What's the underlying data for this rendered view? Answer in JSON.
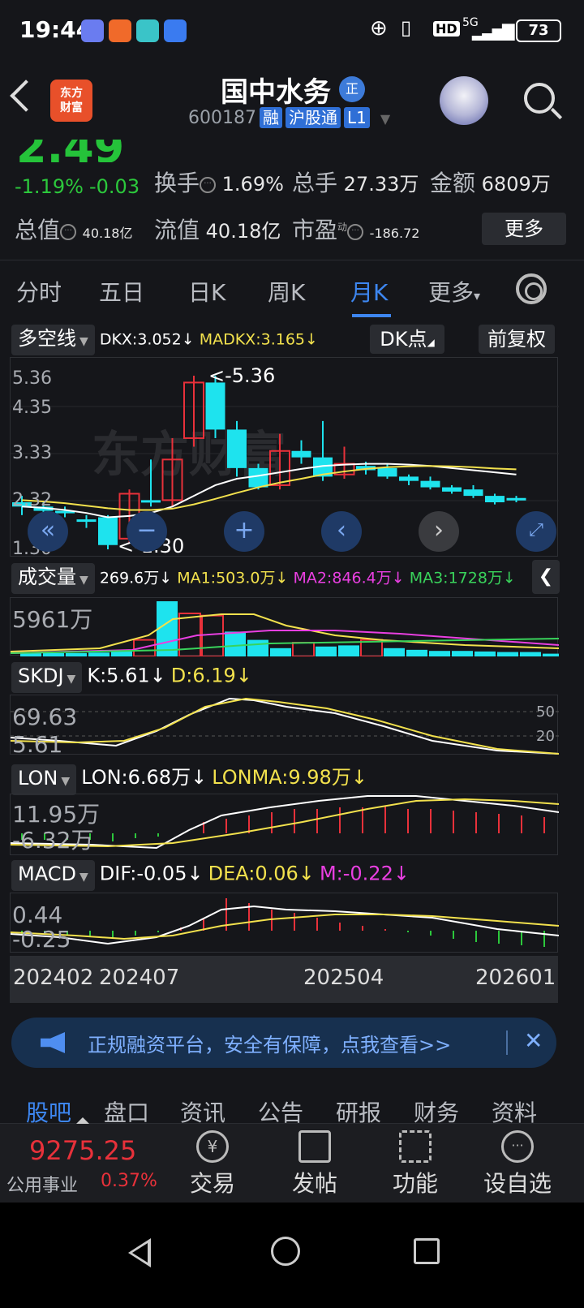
{
  "status_bar": {
    "time": "19:44",
    "network": "5G",
    "hd": "HD",
    "battery": "73"
  },
  "header": {
    "logo_line1": "东方",
    "logo_line2": "财富",
    "stock_name": "国中水务",
    "badge": "正",
    "code": "600187",
    "tags": [
      "融",
      "沪股通",
      "L1"
    ]
  },
  "quote": {
    "price": "2.49",
    "change_pct": "-1.19%",
    "change_amt": "-0.03",
    "turnover_label": "换手",
    "turnover_value": "1.69%",
    "volume_label": "总手",
    "volume_value": "27.33万",
    "amount_label": "金额",
    "amount_value": "6809万",
    "mktcap_label": "总值",
    "mktcap_value": "40.18亿",
    "float_label": "流值",
    "float_value": "40.18亿",
    "pe_label": "市盈",
    "pe_sup": "动",
    "pe_value": "-186.72",
    "more_button": "更多"
  },
  "tabs": [
    "分时",
    "五日",
    "日K",
    "周K",
    "月K",
    "更多"
  ],
  "active_tab": "月K",
  "kline": {
    "indicator": "多空线",
    "dkx": "DKX:3.052↓",
    "madkx": "MADKX:3.165↓",
    "dk_button": "DK点",
    "fq_button": "前复权",
    "y_labels": [
      "5.36",
      "4.35",
      "3.33",
      "2.32",
      "1.30"
    ],
    "high_marker": "<-5.36",
    "low_marker": "<-1.30",
    "candles": [
      {
        "o": 2.3,
        "c": 2.4,
        "h": 2.55,
        "l": 2.1,
        "up": false
      },
      {
        "o": 2.3,
        "c": 2.2,
        "h": 2.4,
        "l": 2.1,
        "up": false
      },
      {
        "o": 2.2,
        "c": 2.15,
        "h": 2.3,
        "l": 2.05,
        "up": false
      },
      {
        "o": 2.0,
        "c": 1.95,
        "h": 2.1,
        "l": 1.8,
        "up": false
      },
      {
        "o": 2.05,
        "c": 1.4,
        "h": 2.1,
        "l": 1.3,
        "up": false
      },
      {
        "o": 1.55,
        "c": 2.6,
        "h": 2.7,
        "l": 1.45,
        "up": true
      },
      {
        "o": 2.45,
        "c": 2.4,
        "h": 3.4,
        "l": 2.3,
        "up": false
      },
      {
        "o": 2.45,
        "c": 3.4,
        "h": 3.9,
        "l": 2.3,
        "up": true
      },
      {
        "o": 3.9,
        "c": 5.2,
        "h": 5.36,
        "l": 3.7,
        "up": true
      },
      {
        "o": 5.2,
        "c": 4.1,
        "h": 5.36,
        "l": 3.9,
        "up": false
      },
      {
        "o": 4.1,
        "c": 3.2,
        "h": 4.3,
        "l": 3.0,
        "up": false
      },
      {
        "o": 3.2,
        "c": 2.75,
        "h": 3.3,
        "l": 2.7,
        "up": false
      },
      {
        "o": 2.8,
        "c": 3.6,
        "h": 4.0,
        "l": 2.7,
        "up": true
      },
      {
        "o": 3.6,
        "c": 3.45,
        "h": 3.85,
        "l": 3.3,
        "up": false
      },
      {
        "o": 3.45,
        "c": 3.0,
        "h": 4.3,
        "l": 2.9,
        "up": false
      },
      {
        "o": 3.05,
        "c": 3.3,
        "h": 3.7,
        "l": 2.95,
        "up": true
      },
      {
        "o": 3.25,
        "c": 3.15,
        "h": 3.35,
        "l": 3.05,
        "up": false
      },
      {
        "o": 3.2,
        "c": 3.0,
        "h": 3.3,
        "l": 2.95,
        "up": false
      },
      {
        "o": 3.0,
        "c": 2.9,
        "h": 3.05,
        "l": 2.8,
        "up": false
      },
      {
        "o": 2.9,
        "c": 2.75,
        "h": 3.0,
        "l": 2.7,
        "up": false
      },
      {
        "o": 2.75,
        "c": 2.65,
        "h": 2.8,
        "l": 2.6,
        "up": false
      },
      {
        "o": 2.7,
        "c": 2.55,
        "h": 2.8,
        "l": 2.5,
        "up": false
      },
      {
        "o": 2.55,
        "c": 2.4,
        "h": 2.6,
        "l": 2.35,
        "up": false
      },
      {
        "o": 2.5,
        "c": 2.48,
        "h": 2.55,
        "l": 2.4,
        "up": false
      }
    ]
  },
  "volume": {
    "indicator": "成交量",
    "value": "269.6万↓",
    "ma1": "MA1:503.0万↓",
    "ma2": "MA2:846.4万↓",
    "ma3": "MA3:1728万↓",
    "y_label": "5961万",
    "bars": [
      0.06,
      0.06,
      0.06,
      0.07,
      0.1,
      0.3,
      1.0,
      0.78,
      0.74,
      0.45,
      0.3,
      0.15,
      0.25,
      0.18,
      0.2,
      0.3,
      0.15,
      0.12,
      0.1,
      0.1,
      0.09,
      0.08,
      0.08,
      0.05
    ],
    "up": [
      false,
      false,
      false,
      false,
      false,
      true,
      false,
      true,
      true,
      false,
      false,
      false,
      true,
      false,
      false,
      true,
      false,
      false,
      false,
      false,
      false,
      false,
      false,
      false
    ]
  },
  "skdj": {
    "indicator": "SKDJ",
    "k": "K:5.61↓",
    "d": "D:6.19↓",
    "y_labels": [
      "69.63",
      "5.61"
    ],
    "right_labels": [
      "50",
      "20"
    ]
  },
  "lon": {
    "indicator": "LON",
    "lon": "LON:6.68万↓",
    "lonma": "LONMA:9.98万↓",
    "y_labels": [
      "11.95万",
      "-6.32万"
    ]
  },
  "macd": {
    "indicator": "MACD",
    "dif": "DIF:-0.05↓",
    "dea": "DEA:0.06↓",
    "m": "M:-0.22↓",
    "y_labels": [
      "0.44",
      "-0.25"
    ]
  },
  "x_axis": [
    "202402",
    "202407",
    "202504",
    "202601"
  ],
  "ad_banner": {
    "text": "正规融资平台，安全有保障，点我查看>>",
    "close": "✕"
  },
  "bottom_tabs": [
    "股吧",
    "盘口",
    "资讯",
    "公告",
    "研报",
    "财务",
    "资料"
  ],
  "dock": {
    "index_value": "9275.25",
    "index_name": "公用事业",
    "index_change": "0.37%",
    "items": [
      "交易",
      "发帖",
      "功能",
      "设自选"
    ]
  },
  "colors": {
    "up": "#e8313a",
    "down": "#1ee3ee",
    "accent": "#3d86f0",
    "dkx_line": "#ffffff",
    "madkx_line": "#f2e14d"
  }
}
